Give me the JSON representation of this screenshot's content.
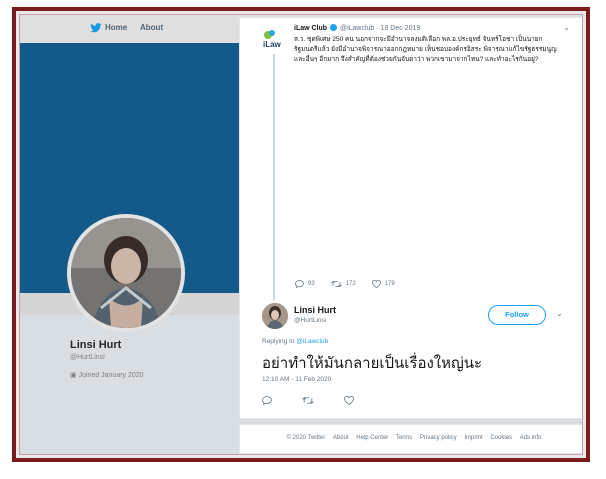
{
  "background_page": {
    "nav": {
      "home": "Home",
      "about": "About"
    },
    "profile": {
      "name": "Linsi Hurt",
      "handle": "@HurtLinsi",
      "joined": "Joined January 2020"
    },
    "colors": {
      "banner": "#155f93",
      "frame": "#7a1c1c"
    }
  },
  "quoted_tweet": {
    "author_name": "iLaw Club",
    "author_handle": "@iLawclub",
    "date": "18 Dec 2019",
    "logo_text": "iLaw",
    "body": "ส.ว. ชุดพิเศษ 250 คน นอกจากจะมีอำนาจลงมติเลือก พล.อ.ประยุทธ์ จันทร์โอชา เป็นนายกรัฐมนตรีแล้ว ยังมีอำนาจพิจารณาออกกฎหมาย เห็นชอบองค์กรอิสระ พิจารณาแก้ไขรัฐธรรมนูญ และอื่นๆ อีกมาก จึงสำคัญที่ต้องช่วยกันจับตาว่า พวกเขามาจากไหน? และทำอะไรกันอยู่?",
    "replies": "93",
    "retweets": "172",
    "likes": "179"
  },
  "reply_tweet": {
    "author_name": "Linsi Hurt",
    "author_handle": "@HurtLinsi",
    "follow_label": "Follow",
    "replying_prefix": "Replying to",
    "replying_to": "@iLawclub",
    "text": "อย่าทำให้มันกลายเป็นเรื่องใหญ่นะ",
    "timestamp": "12:10 AM - 11 Feb 2020",
    "accent": "#1da1f2"
  },
  "footer": {
    "links": [
      "© 2020 Twitter",
      "About",
      "Help Center",
      "Terms",
      "Privacy policy",
      "Imprint",
      "Cookies",
      "Ads info"
    ]
  }
}
